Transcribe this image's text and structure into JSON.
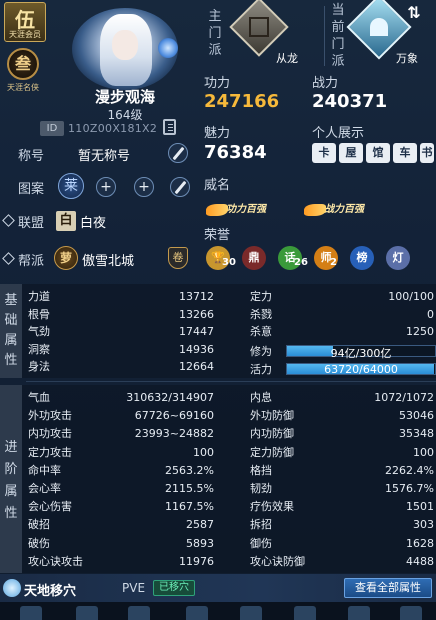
{
  "badges": {
    "rank_char": "伍",
    "rank_sub": "天涯会员",
    "seal_char": "叁",
    "seal_sub": "天涯名侠"
  },
  "player": {
    "name": "漫步观海",
    "level": "164级",
    "id_tag": "ID",
    "id_value": "110Z00X181X2"
  },
  "profile": {
    "title_label": "称号",
    "title_value": "暂无称号",
    "pattern_label": "图案",
    "pattern_char": "莱",
    "alliance_label": "联盟",
    "alliance_char": "白",
    "alliance_value": "白夜",
    "guild_label": "帮派",
    "guild_char": "萝",
    "guild_value": "傲雪北城",
    "guild_shield": "卷"
  },
  "sect": {
    "main_tab": [
      "主",
      "门",
      "派"
    ],
    "main_name": "从龙",
    "current_tab": [
      "当",
      "前",
      "门",
      "派"
    ],
    "current_name": "万象",
    "switch_glyph": "⇅"
  },
  "power": {
    "combat_label": "功力",
    "combat_value": "247166",
    "battle_label": "战力",
    "battle_value": "240371",
    "charm_label": "魅力",
    "charm_value": "76384",
    "showcase_label": "个人展示",
    "showcase_icons": [
      "卡",
      "屋",
      "馆",
      "车",
      "书"
    ],
    "renown_label": "威名",
    "renown_banners": [
      "功力百强",
      "战力百强"
    ],
    "honor_label": "荣誉",
    "honor_items": [
      {
        "glyph": "🏆",
        "count": "30",
        "color": "#c8962e"
      },
      {
        "glyph": "鼎",
        "count": "",
        "color": "#7a2a2a"
      },
      {
        "glyph": "话",
        "count": "26",
        "color": "#3a9a3a"
      },
      {
        "glyph": "师",
        "count": "2",
        "color": "#d47f16"
      },
      {
        "glyph": "榜",
        "count": "",
        "color": "#2760b8"
      },
      {
        "glyph": "灯",
        "count": "",
        "color": "#5b6fa8"
      }
    ]
  },
  "basic_attributes": {
    "side_label": [
      "基",
      "础",
      "属",
      "性"
    ],
    "left": [
      {
        "name": "力道",
        "value": "13712"
      },
      {
        "name": "根骨",
        "value": "13266"
      },
      {
        "name": "气劲",
        "value": "17447"
      },
      {
        "name": "洞察",
        "value": "14936"
      },
      {
        "name": "身法",
        "value": "12664"
      }
    ],
    "right": [
      {
        "name": "定力",
        "value": "100/100"
      },
      {
        "name": "杀戮",
        "value": "0"
      },
      {
        "name": "杀意",
        "value": "1250"
      }
    ],
    "cultivation_label": "修为",
    "cultivation_text": "94亿/300亿",
    "cultivation_ratio": 0.313,
    "vitality_label": "活力",
    "vitality_text": "63720/64000",
    "vitality_ratio": 0.9956
  },
  "advanced_attributes": {
    "side_label": [
      "进",
      "阶",
      "属",
      "性"
    ],
    "left": [
      {
        "name": "气血",
        "value": "310632/314907"
      },
      {
        "name": "外功攻击",
        "value": "67726~69160"
      },
      {
        "name": "内功攻击",
        "value": "23993~24882"
      },
      {
        "name": "定力攻击",
        "value": "100"
      },
      {
        "name": "命中率",
        "value": "2563.2%"
      },
      {
        "name": "会心率",
        "value": "2115.5%"
      },
      {
        "name": "会心伤害",
        "value": "1167.5%"
      },
      {
        "name": "破招",
        "value": "2587"
      },
      {
        "name": "破伤",
        "value": "5893"
      },
      {
        "name": "攻心诀攻击",
        "value": "11976"
      }
    ],
    "right": [
      {
        "name": "内息",
        "value": "1072/1072"
      },
      {
        "name": "外功防御",
        "value": "53046"
      },
      {
        "name": "内功防御",
        "value": "35348"
      },
      {
        "name": "定力防御",
        "value": "100"
      },
      {
        "name": "格挡",
        "value": "2262.4%"
      },
      {
        "name": "韧劲",
        "value": "1576.7%"
      },
      {
        "name": "疗伤效果",
        "value": "1501"
      },
      {
        "name": "拆招",
        "value": "303"
      },
      {
        "name": "御伤",
        "value": "1628"
      },
      {
        "name": "攻心诀防御",
        "value": "4488"
      }
    ]
  },
  "footer": {
    "title": "天地移穴",
    "mode": "PVE",
    "badge": "已移穴",
    "button": "查看全部属性"
  }
}
